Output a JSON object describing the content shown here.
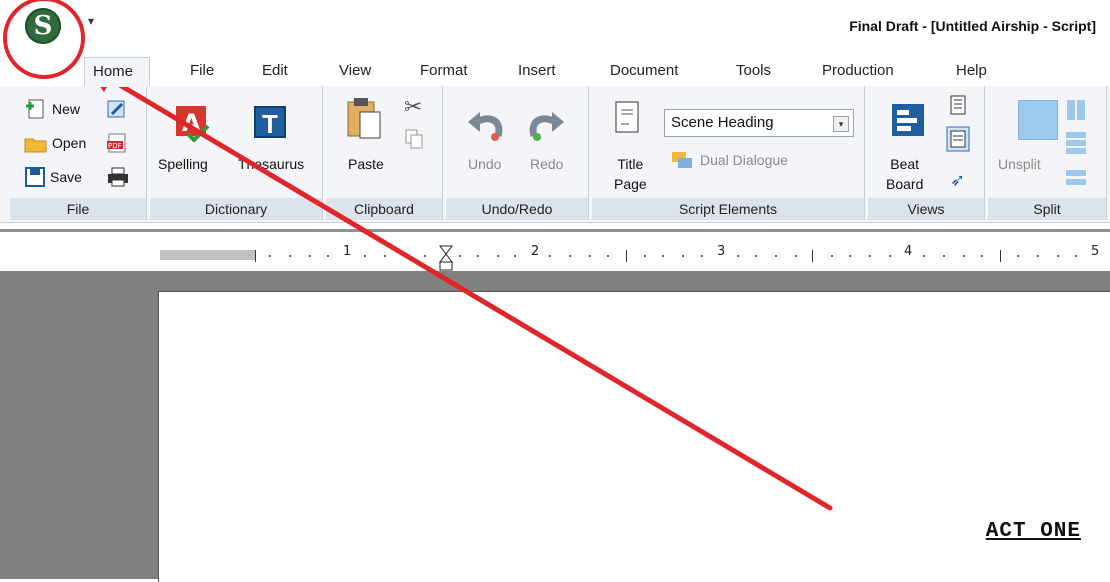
{
  "window": {
    "title": "Final Draft - [Untitled Airship - Script]"
  },
  "app_button": {
    "glyph": "S",
    "icon": "final-draft-logo-icon"
  },
  "qat": {
    "glyph": "▾"
  },
  "tabs": [
    {
      "label": "Home",
      "active": true
    },
    {
      "label": "File"
    },
    {
      "label": "Edit"
    },
    {
      "label": "View"
    },
    {
      "label": "Format"
    },
    {
      "label": "Insert"
    },
    {
      "label": "Document"
    },
    {
      "label": "Tools"
    },
    {
      "label": "Production"
    },
    {
      "label": "Help"
    }
  ],
  "ribbon": {
    "file": {
      "label": "File",
      "new": "New",
      "open": "Open",
      "save": "Save"
    },
    "dictionary": {
      "label": "Dictionary",
      "spelling": "Spelling",
      "thesaurus": "Thesaurus",
      "thesaurus_glyph": "T"
    },
    "clipboard": {
      "label": "Clipboard",
      "paste": "Paste"
    },
    "undo_redo": {
      "label": "Undo/Redo",
      "undo": "Undo",
      "redo": "Redo"
    },
    "script_elements": {
      "label": "Script Elements",
      "title_page_1": "Title",
      "title_page_2": "Page",
      "element_select": "Scene Heading",
      "dual_dialogue": "Dual Dialogue"
    },
    "views": {
      "label": "Views",
      "beat_1": "Beat",
      "beat_2": "Board"
    },
    "split": {
      "label": "Split",
      "unsplit": "Unsplit"
    }
  },
  "ruler": {
    "marks": [
      "1",
      "2",
      "3",
      "4",
      "5"
    ]
  },
  "document": {
    "text": "ACT ONE"
  },
  "colors": {
    "annotation_red": "#e0252b",
    "app_green": "#2f6b3c",
    "ribbon_bg": "#f3f5f8"
  }
}
